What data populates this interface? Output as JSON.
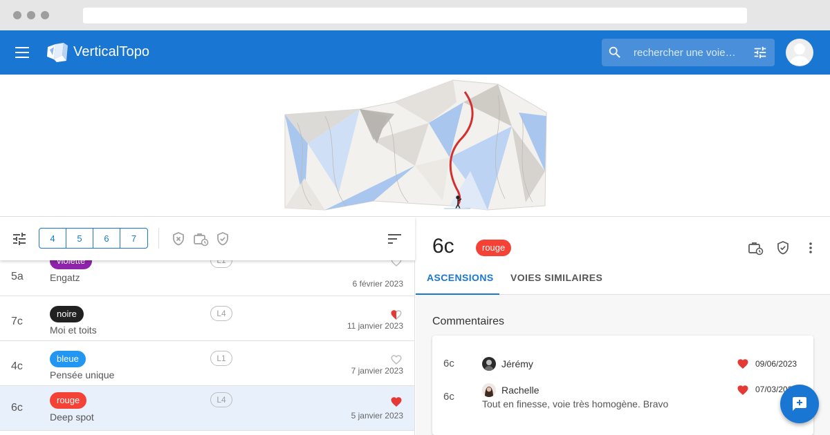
{
  "app": {
    "title": "VerticalTopo"
  },
  "search": {
    "placeholder": "rechercher une voie…"
  },
  "filters": {
    "grades": [
      "4",
      "5",
      "6",
      "7"
    ]
  },
  "routes": [
    {
      "grade": "5a",
      "color_label": "violette",
      "color": "#8e24aa",
      "name": "Engatz",
      "pitch": "L1",
      "date": "6 février 2023",
      "liked": "none"
    },
    {
      "grade": "7c",
      "color_label": "noire",
      "color": "#212121",
      "name": "Moi et toits",
      "pitch": "L4",
      "date": "11 janvier 2023",
      "liked": "half"
    },
    {
      "grade": "4c",
      "color_label": "bleue",
      "color": "#2196f3",
      "name": "Pensée unique",
      "pitch": "L1",
      "date": "7 janvier 2023",
      "liked": "none"
    },
    {
      "grade": "6c",
      "color_label": "rouge",
      "color": "#f44336",
      "name": "Deep spot",
      "pitch": "L4",
      "date": "5 janvier 2023",
      "liked": "full"
    }
  ],
  "detail": {
    "grade": "6c",
    "color_label": "rouge",
    "tabs": [
      "ASCENSIONS",
      "VOIES SIMILAIRES"
    ],
    "comments_title": "Commentaires",
    "comments": [
      {
        "grade": "6c",
        "user": "Jérémy",
        "date": "09/06/2023",
        "text": ""
      },
      {
        "grade": "6c",
        "user": "Rachelle",
        "date": "07/03/2023",
        "text": "Tout en finesse, voie très homogène. Bravo"
      }
    ]
  },
  "colors": {
    "primary": "#1976d2",
    "red": "#f44336",
    "selected_row": "#e8f0fb"
  },
  "icons": [
    "menu-icon",
    "search-icon",
    "tune-icon",
    "sort-icon",
    "heart-icon",
    "shield-x-icon",
    "briefcase-clock-icon",
    "shield-check-icon",
    "more-vert-icon",
    "add-comment-icon"
  ]
}
